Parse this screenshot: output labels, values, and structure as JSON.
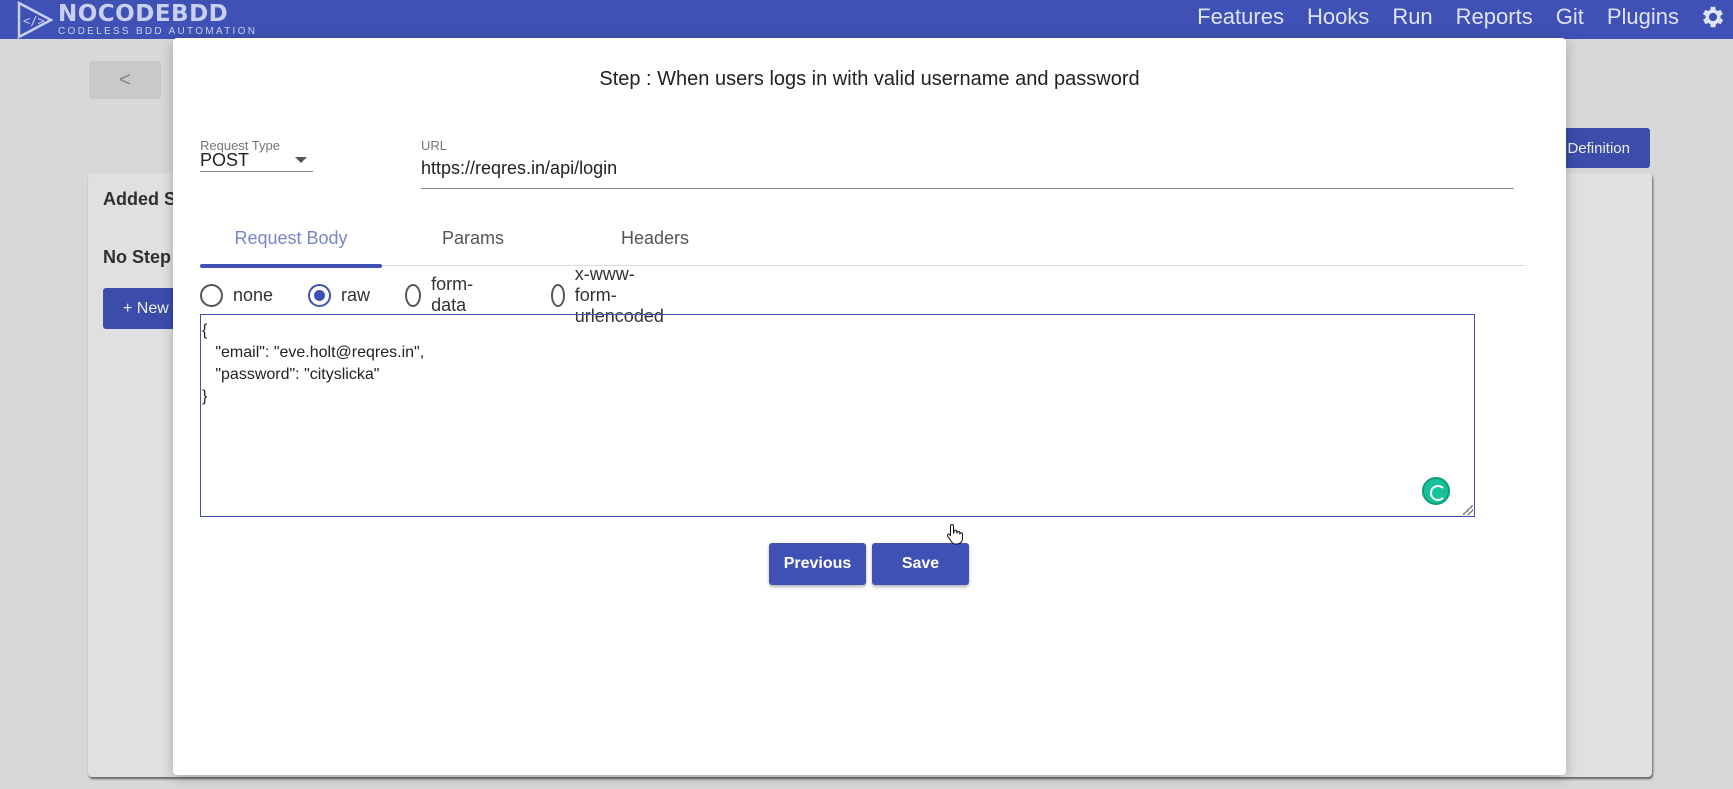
{
  "app": {
    "logo_title": "NOCODEBDD",
    "logo_subtitle": "CODELESS BDD AUTOMATION"
  },
  "nav": {
    "items": [
      "Features",
      "Hooks",
      "Run",
      "Reports",
      "Git",
      "Plugins"
    ]
  },
  "background": {
    "back_icon": "chevron-left-icon",
    "back_label": "<",
    "definition_button": "Definition",
    "panel_heading": "Added S",
    "empty_text": "No Step",
    "new_button": "+ New"
  },
  "modal": {
    "title": "Step : When users logs in with valid username and password",
    "request_type": {
      "label": "Request Type",
      "value": "POST"
    },
    "url": {
      "label": "URL",
      "value": "https://reqres.in/api/login"
    },
    "tabs": [
      {
        "label": "Request Body",
        "active": true
      },
      {
        "label": "Params",
        "active": false
      },
      {
        "label": "Headers",
        "active": false
      }
    ],
    "body_types": [
      {
        "label": "none",
        "selected": false
      },
      {
        "label": "raw",
        "selected": true
      },
      {
        "label": "form-data",
        "selected": false
      },
      {
        "label": "x-www-form-urlencoded",
        "selected": false
      }
    ],
    "request_body": "{\n   \"email\": \"eve.holt@reqres.in\",\n   \"password\": \"cityslicka\"\n}",
    "previous_button": "Previous",
    "save_button": "Save"
  },
  "colors": {
    "primary": "#3f51b5",
    "active_tab_text": "#7986cb",
    "grammar_badge": "#15c39a"
  }
}
